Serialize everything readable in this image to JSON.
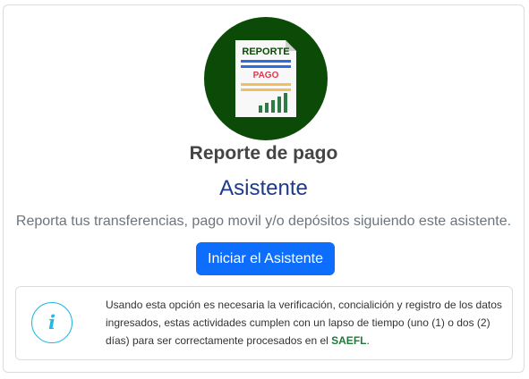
{
  "logo": {
    "icon": "payment-report-document-icon",
    "text_line1": "REPORTE",
    "text_line2": "PAGO",
    "circle_color": "#0b4a07"
  },
  "title": "Reporte de pago",
  "subtitle": "Asistente",
  "description": "Reporta tus transferencias, pago movil y/o depósitos siguiendo este asistente.",
  "start_button_label": "Iniciar el Asistente",
  "info": {
    "icon": "info-icon",
    "icon_glyph": "i",
    "text": "Usando esta opción es necesaria la verificación, concialición y registro de los datos ingresados, estas actividades cumplen con un lapso de tiempo (uno (1) o dos (2) días) para ser correctamente procesados en el",
    "brand": "SAEFL",
    "suffix": "."
  },
  "colors": {
    "primary_button": "#0d6efd",
    "subtitle": "#1e3a8a",
    "brand": "#1f7a3a",
    "info_accent": "#22b8e0"
  }
}
